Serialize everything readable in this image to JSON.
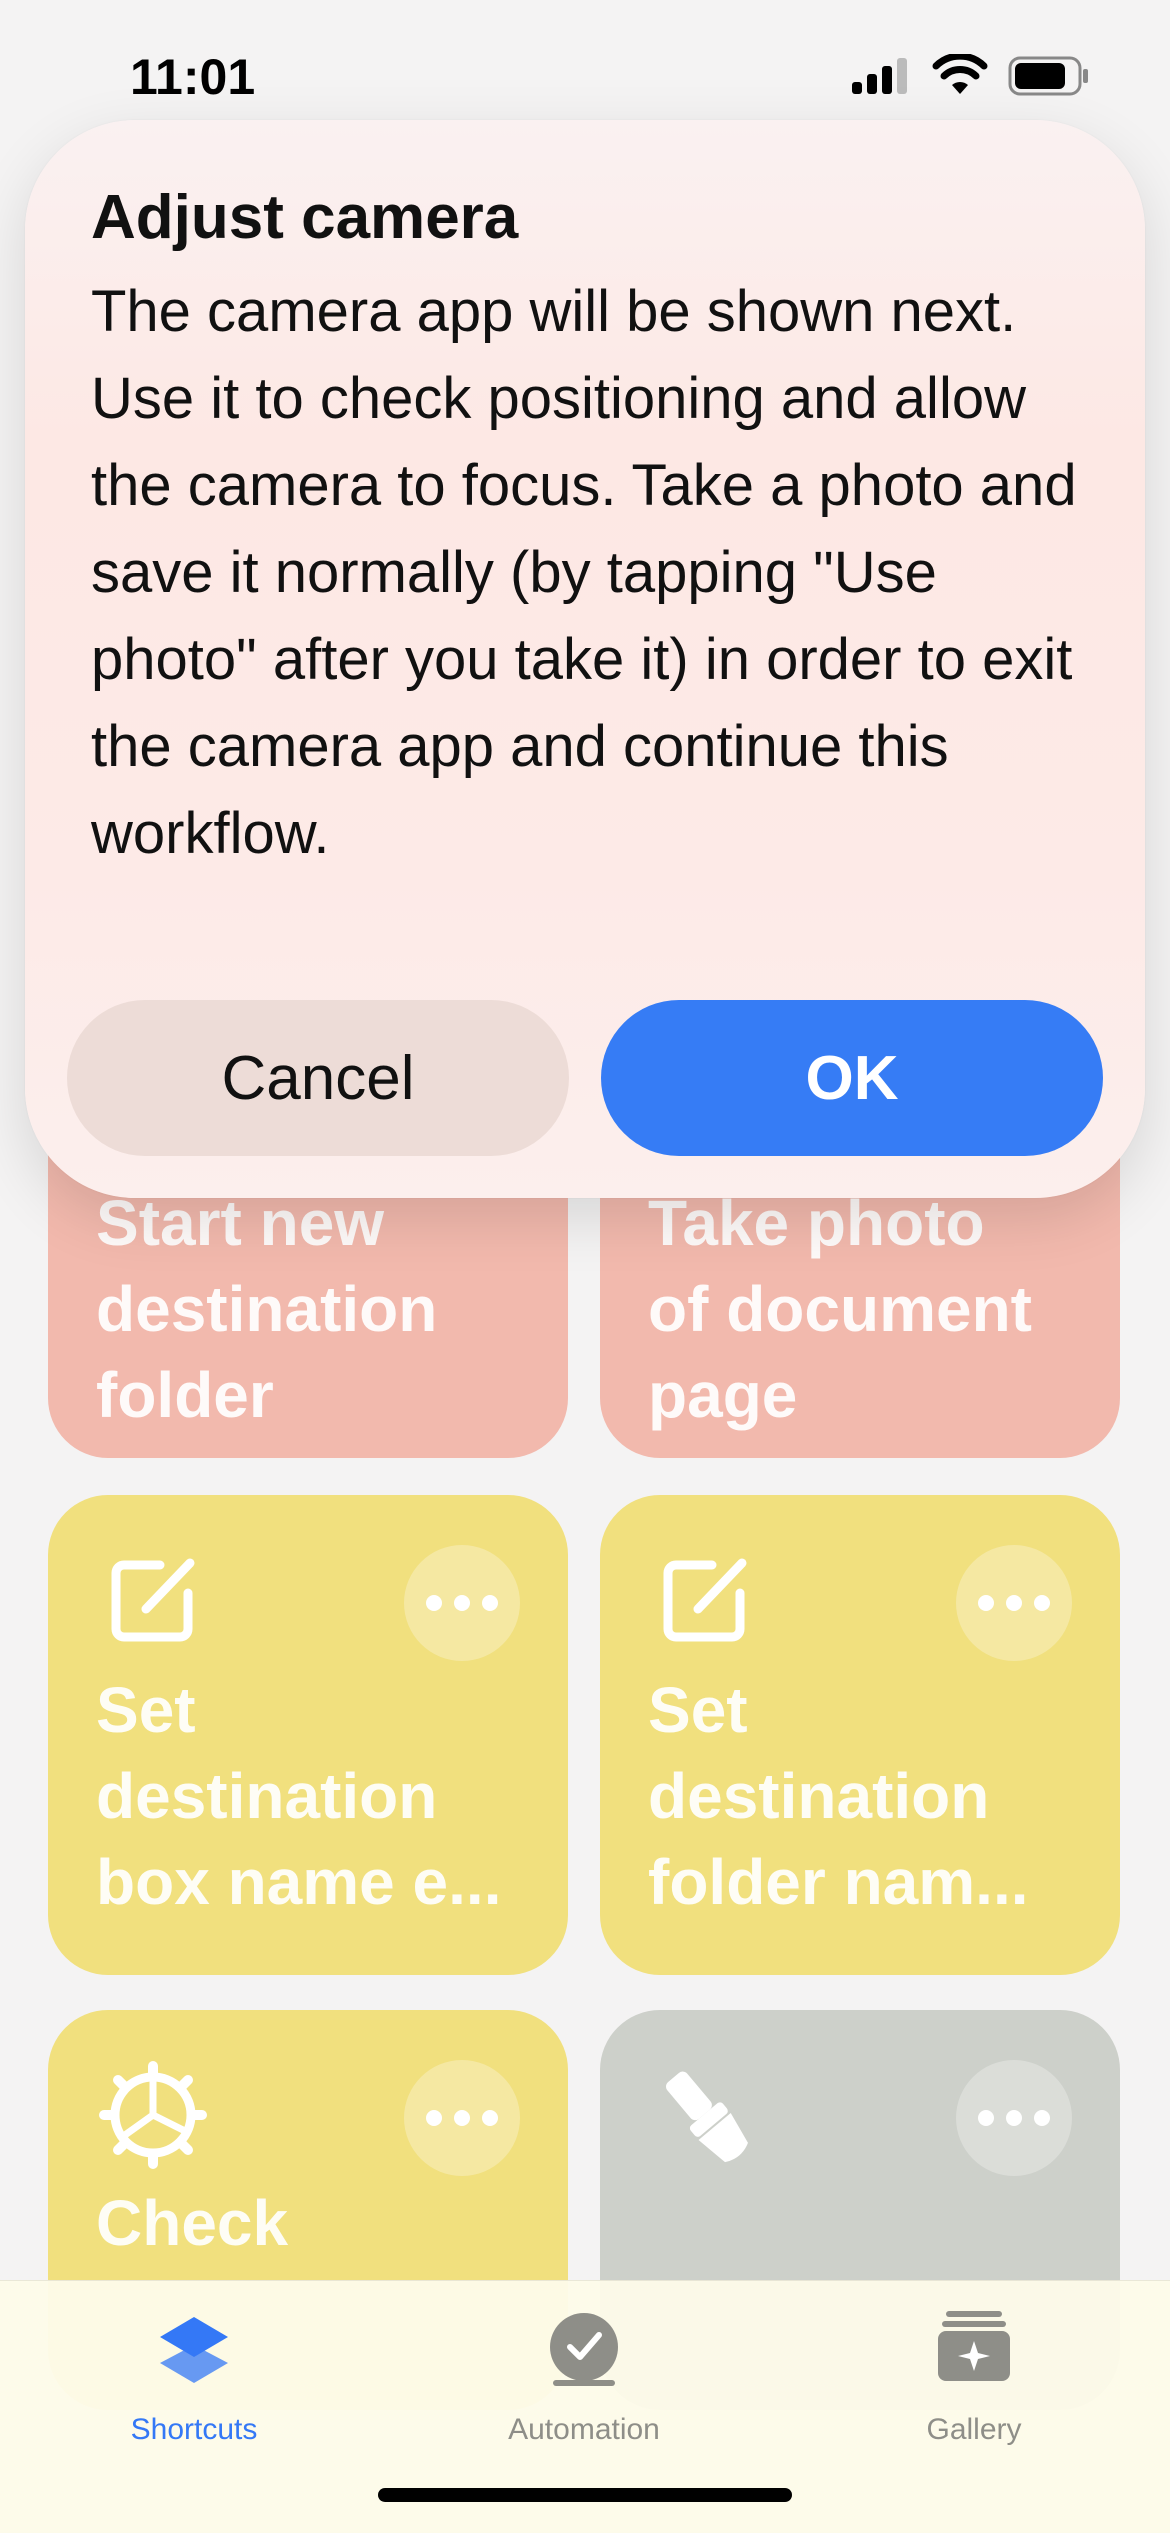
{
  "status_bar": {
    "time": "11:01"
  },
  "tiles": [
    {
      "title": "Start new\ndestination\nfolder",
      "color": "#f2b9ad"
    },
    {
      "title": "Take photo\nof document\npage",
      "color": "#f2b9ad"
    },
    {
      "title": "Set\ndestination\nbox name e...",
      "icon": "square-pencil-icon",
      "color": "#f1e07e"
    },
    {
      "title": "Set\ndestination\nfolder nam...",
      "icon": "square-pencil-icon",
      "color": "#f1e07e"
    },
    {
      "title": "Check",
      "icon": "gear-icon",
      "color": "#f1e07e"
    },
    {
      "title": "",
      "icon": "paintbrush-icon",
      "color": "#cdd0ca"
    }
  ],
  "dialog": {
    "title": "Adjust camera",
    "message": "The camera app will be shown next. Use it to check positioning and allow the camera to focus. Take a photo and save it normally (by tapping \"Use photo\" after you take it) in order to exit the camera app and continue this workflow.",
    "cancel_label": "Cancel",
    "ok_label": "OK"
  },
  "tabbar": {
    "tabs": [
      {
        "label": "Shortcuts",
        "icon": "layers-icon",
        "active": true,
        "color": "#3478f6"
      },
      {
        "label": "Automation",
        "icon": "clock-check-icon",
        "active": false,
        "color": "#8e8e88"
      },
      {
        "label": "Gallery",
        "icon": "sparkle-stack-icon",
        "active": false,
        "color": "#8e8e88"
      }
    ]
  },
  "colors": {
    "accent": "#367cf5",
    "salmon_tile": "#f2b9ad",
    "yellow_tile": "#f1e07e",
    "gray_tile": "#cdd0ca"
  }
}
